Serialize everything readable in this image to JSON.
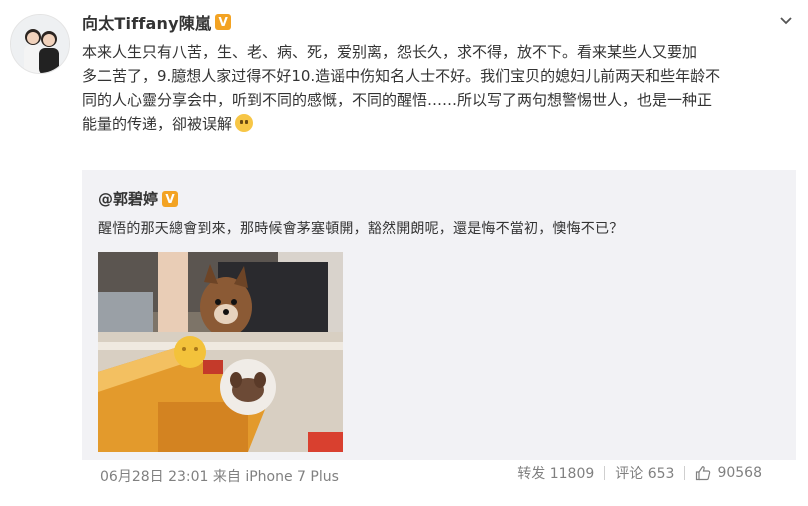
{
  "post": {
    "author": "向太Tiffany陳嵐",
    "verified_badge": "V",
    "text_lines": [
      "本来人生只有八苦，生、老、病、死，爱别离，怨长久，求不得，放不下。看来某些人又要加",
      "多二苦了，9.臆想人家过得不好10.造谣中伤知名人士不好。我们宝贝的媳妇儿前两天和些年龄不",
      "同的人心靈分享会中，听到不同的感慨，不同的醒悟……所以写了两句想警惕世人，也是一种正",
      "能量的传递，卻被误解"
    ],
    "emoji": "sad-emoji"
  },
  "repost": {
    "author": "@郭碧婷",
    "verified_badge": "V",
    "text": "醒悟的那天總會到來，那時候會茅塞頓開，豁然開朗呢，還是悔不當初，懊悔不已？"
  },
  "footer": {
    "meta": "06月28日 23:01 来自 iPhone 7 Plus",
    "repost_label": "转发 11809",
    "comment_label": "评论 653",
    "like_count": "90568"
  },
  "colors": {
    "badge": "#f3a323",
    "repost_bg": "#f2f2f5",
    "meta_gray": "#808080"
  }
}
